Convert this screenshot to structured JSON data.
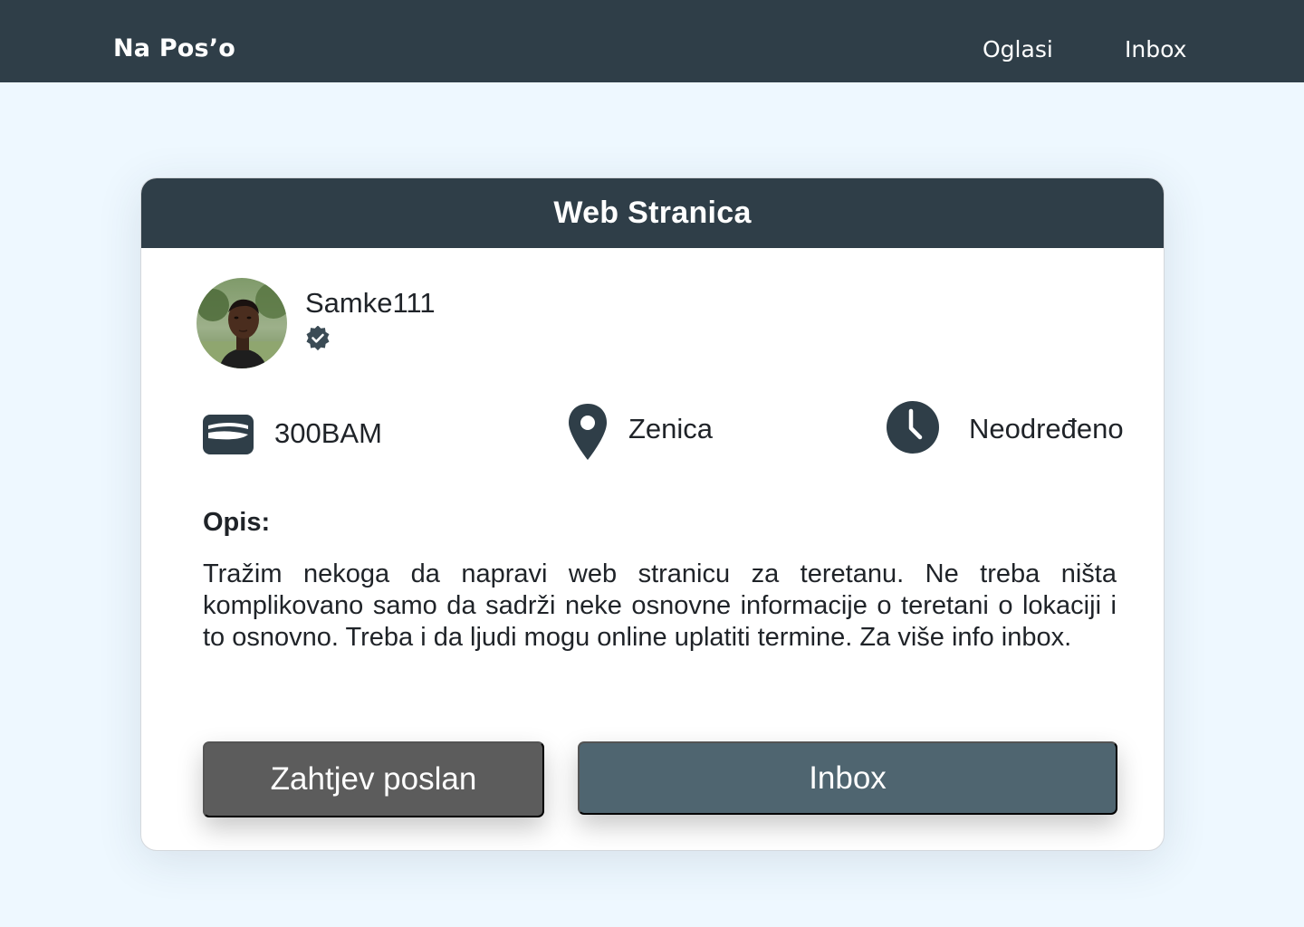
{
  "navbar": {
    "brand": "Na Pos’o",
    "links": [
      "Oglasi",
      "Inbox"
    ]
  },
  "listing": {
    "title": "Web Stranica",
    "user": {
      "username": "Samke111",
      "verified": true
    },
    "stats": {
      "price": "300BAM",
      "location": "Zenica",
      "duration": "Neodređeno"
    },
    "description_label": "Opis:",
    "description": "Tražim nekoga da napravi web stranicu za teretanu. Ne treba ništa komplikovano samo da sadrži neke osnovne informacije o teretani o lokaciji i to osnovno. Treba i da ljudi mogu online uplatiti termine. Za više info inbox.",
    "actions": {
      "request_label": "Zahtjev poslan",
      "inbox_label": "Inbox"
    }
  },
  "colors": {
    "navbar_bg": "#2f3e48",
    "page_bg": "#eef8ff",
    "request_button": "#5c5c5c",
    "inbox_button": "#4f6570"
  },
  "icons": [
    "wallet-icon",
    "location-pin-icon",
    "clock-icon",
    "verified-badge-icon"
  ]
}
